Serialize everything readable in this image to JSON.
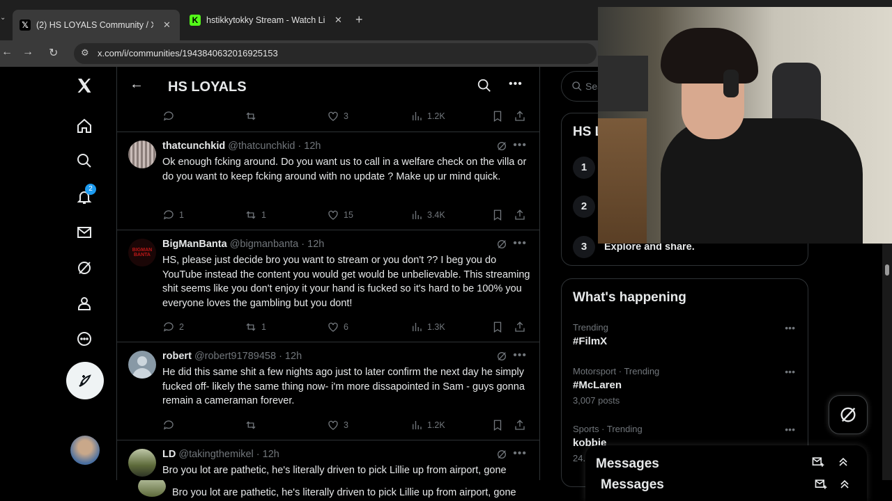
{
  "browser": {
    "tabs": [
      {
        "title": "(2) HS LOYALS Community / X",
        "icon": "x-logo-icon",
        "active": true
      },
      {
        "title": "hstikkytokky Stream - Watch Li",
        "icon": "kick-logo-icon",
        "active": false
      }
    ],
    "url": "x.com/i/communities/1943840632016925153"
  },
  "nav": {
    "notifications_badge": "2"
  },
  "community": {
    "title": "HS LOYALS"
  },
  "top_post_actions": {
    "replies": "",
    "retweets": "",
    "likes": "3",
    "views": "1.2K"
  },
  "posts": [
    {
      "name": "thatcunchkid",
      "handle": "@thatcunchkid · 12h",
      "text": "Ok enough fcking around. Do you want us to call in a welfare check on the villa or do you want to keep fcking around with no update ? Make up ur mind quick.",
      "replies": "1",
      "retweets": "1",
      "likes": "15",
      "views": "3.4K"
    },
    {
      "name": "BigManBanta",
      "handle": "@bigmanbanta · 12h",
      "text": "HS, please just decide bro you want to stream or you don't ??  I beg you do YouTube instead the content you would get would be unbelievable. This streaming shit seems like you don't enjoy it your hand is fucked so it's hard to be 100% you everyone loves the gambling but you dont!",
      "replies": "2",
      "retweets": "1",
      "likes": "6",
      "views": "1.3K"
    },
    {
      "name": "robert",
      "handle": "@robert91789458 · 12h",
      "text": "He did this same shit a few nights ago just to later confirm the next day he simply fucked off- likely the same thing now- i'm more dissapointed in Sam - guys gonna remain a cameraman forever.",
      "replies": "",
      "retweets": "",
      "likes": "3",
      "views": "1.2K"
    },
    {
      "name": "LD",
      "handle": "@takingthemikel · 12h",
      "text": "Bro you lot are pathetic, he's literally driven to pick Lillie up from airport, gone",
      "replies": "",
      "retweets": "",
      "likes": "",
      "views": ""
    }
  ],
  "ghost_post_text": "Bro you lot are pathetic, he's literally driven to pick Lillie up from airport, gone",
  "search": {
    "placeholder": "Sea"
  },
  "community_card": {
    "title": "HS L",
    "rules": [
      {
        "num": "1",
        "text": ""
      },
      {
        "num": "2",
        "text": ""
      },
      {
        "num": "3",
        "text": "Explore and share."
      }
    ]
  },
  "happening": {
    "title": "What's happening",
    "trends": [
      {
        "category": "Trending",
        "title": "#FilmX",
        "count": ""
      },
      {
        "category": "Motorsport · Trending",
        "title": "#McLaren",
        "count": "3,007 posts"
      },
      {
        "category": "Sports · Trending",
        "title": "kobbie",
        "count": "24."
      }
    ]
  },
  "messages": {
    "title": "Messages",
    "title_ghost": "Messages"
  },
  "colors": {
    "background": "#000000",
    "border": "#2f3336",
    "muted": "#71767b",
    "text": "#e7e9ea",
    "badge": "#1d9bf0"
  }
}
